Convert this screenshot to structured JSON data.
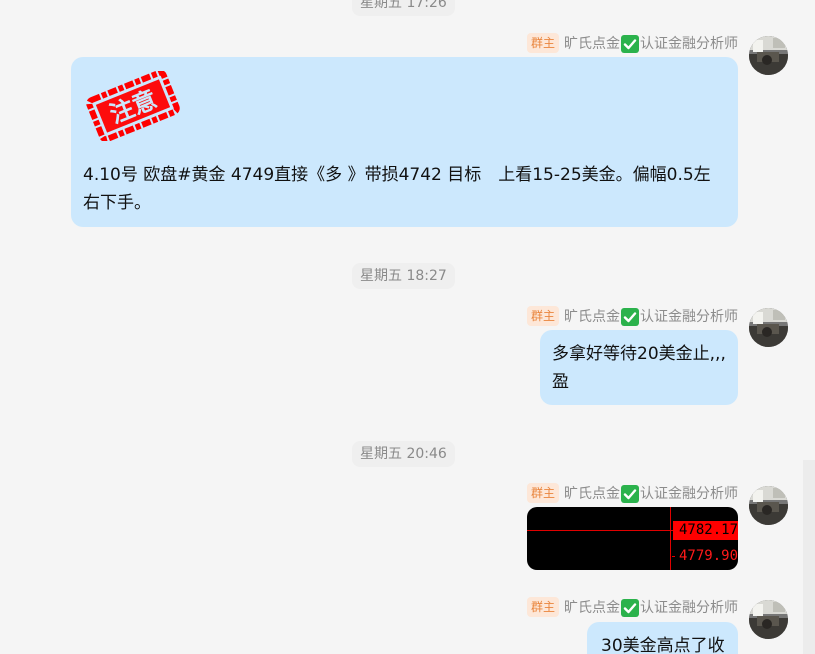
{
  "messages": [
    {
      "time": "星期五 17:26",
      "badge": "群主",
      "sender_name": "旷氏点金",
      "sender_title": "认证金融分析师",
      "stamp_text": "注意",
      "text": "4.10号 欧盘#黄金 4749直接《多 》带损4742 目标　上看15-25美金。偏幅0.5左右下手。"
    },
    {
      "time": "星期五 18:27",
      "badge": "群主",
      "sender_name": "旷氏点金",
      "sender_title": "认证金融分析师",
      "text": "多拿好等待20美金止,,,盈"
    },
    {
      "time": "星期五 20:46",
      "badge": "群主",
      "sender_name": "旷氏点金",
      "sender_title": "认证金融分析师",
      "price_high": "4782.17",
      "price_low": "4779.90"
    },
    {
      "badge": "群主",
      "sender_name": "旷氏点金",
      "sender_title": "认证金融分析师",
      "text": "30美金高点了收"
    }
  ],
  "colors": {
    "background": "#f5f5f5",
    "bubble": "#cce8fd",
    "badge_bg": "#fde7d8",
    "badge_text": "#e9853d",
    "verified": "#2bb24c",
    "stamp": "#ff0000",
    "chart_bg": "#000000",
    "chart_line": "#e00000"
  },
  "icons": [
    "verified-check-icon",
    "avatar-image",
    "attention-stamp-image"
  ]
}
